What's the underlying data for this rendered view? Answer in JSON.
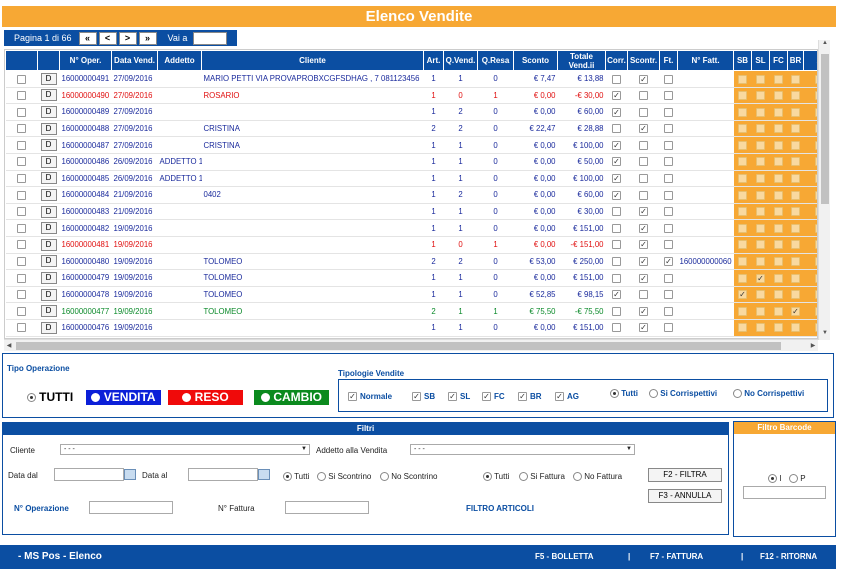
{
  "title": "Elenco Vendite",
  "pager": {
    "page_label": "Pagina 1 di 66",
    "first": "«",
    "prev": "<",
    "next": ">",
    "last": "»",
    "goto_label": "Vai a",
    "goto_value": ""
  },
  "table": {
    "headers": [
      "",
      "",
      "N° Oper.",
      "Data Vend.",
      "Addetto",
      "Cliente",
      "Art.",
      "Q.Vend.",
      "Q.Resa",
      "Sconto",
      "Totale Vend.ii",
      "Corr.",
      "Scontr.",
      "Ft.",
      "N° Fatt.",
      "SB",
      "SL",
      "FC",
      "BR",
      "A"
    ],
    "detail_label": "D",
    "rows": [
      {
        "color": "blue",
        "oper": "16000000491",
        "date": "27/09/2016",
        "addetto": "",
        "cliente": "MARIO PETTI VIA PROVAPROBXCGFSDHAG , 7 081123456",
        "art": "1",
        "qv": "1",
        "qr": "0",
        "sconto": "€ 7,47",
        "totale": "€ 13,88",
        "corr": false,
        "scontr": true,
        "ft": false,
        "fatt": "",
        "sb": false,
        "sl": false,
        "fc": false,
        "br": false,
        "a": false
      },
      {
        "color": "red",
        "oper": "16000000490",
        "date": "27/09/2016",
        "addetto": "",
        "cliente": "ROSARIO",
        "art": "1",
        "qv": "0",
        "qr": "1",
        "sconto": "€ 0,00",
        "totale": "-€ 30,00",
        "corr": true,
        "scontr": false,
        "ft": false,
        "fatt": "",
        "sb": false,
        "sl": false,
        "fc": false,
        "br": false,
        "a": false
      },
      {
        "color": "blue",
        "oper": "16000000489",
        "date": "27/09/2016",
        "addetto": "",
        "cliente": "",
        "art": "1",
        "qv": "2",
        "qr": "0",
        "sconto": "€ 0,00",
        "totale": "€ 60,00",
        "corr": true,
        "scontr": false,
        "ft": false,
        "fatt": "",
        "sb": false,
        "sl": false,
        "fc": false,
        "br": false,
        "a": false
      },
      {
        "color": "blue",
        "oper": "16000000488",
        "date": "27/09/2016",
        "addetto": "",
        "cliente": "CRISTINA",
        "art": "2",
        "qv": "2",
        "qr": "0",
        "sconto": "€ 22,47",
        "totale": "€ 28,88",
        "corr": false,
        "scontr": true,
        "ft": false,
        "fatt": "",
        "sb": false,
        "sl": false,
        "fc": false,
        "br": false,
        "a": false
      },
      {
        "color": "blue",
        "oper": "16000000487",
        "date": "27/09/2016",
        "addetto": "",
        "cliente": "CRISTINA",
        "art": "1",
        "qv": "1",
        "qr": "0",
        "sconto": "€ 0,00",
        "totale": "€ 100,00",
        "corr": true,
        "scontr": false,
        "ft": false,
        "fatt": "",
        "sb": false,
        "sl": false,
        "fc": false,
        "br": false,
        "a": true
      },
      {
        "color": "blue",
        "oper": "16000000486",
        "date": "26/09/2016",
        "addetto": "ADDETTO 1",
        "cliente": "",
        "art": "1",
        "qv": "1",
        "qr": "0",
        "sconto": "€ 0,00",
        "totale": "€ 50,00",
        "corr": true,
        "scontr": false,
        "ft": false,
        "fatt": "",
        "sb": false,
        "sl": false,
        "fc": false,
        "br": false,
        "a": false
      },
      {
        "color": "blue",
        "oper": "16000000485",
        "date": "26/09/2016",
        "addetto": "ADDETTO 1",
        "cliente": "",
        "art": "1",
        "qv": "1",
        "qr": "0",
        "sconto": "€ 0,00",
        "totale": "€ 100,00",
        "corr": true,
        "scontr": false,
        "ft": false,
        "fatt": "",
        "sb": false,
        "sl": false,
        "fc": false,
        "br": false,
        "a": false
      },
      {
        "color": "blue",
        "oper": "16000000484",
        "date": "21/09/2016",
        "addetto": "",
        "cliente": "0402",
        "art": "1",
        "qv": "2",
        "qr": "0",
        "sconto": "€ 0,00",
        "totale": "€ 60,00",
        "corr": true,
        "scontr": false,
        "ft": false,
        "fatt": "",
        "sb": false,
        "sl": false,
        "fc": false,
        "br": false,
        "a": false
      },
      {
        "color": "blue",
        "oper": "16000000483",
        "date": "21/09/2016",
        "addetto": "",
        "cliente": "",
        "art": "1",
        "qv": "1",
        "qr": "0",
        "sconto": "€ 0,00",
        "totale": "€ 30,00",
        "corr": false,
        "scontr": true,
        "ft": false,
        "fatt": "",
        "sb": false,
        "sl": false,
        "fc": false,
        "br": false,
        "a": false
      },
      {
        "color": "blue",
        "oper": "16000000482",
        "date": "19/09/2016",
        "addetto": "",
        "cliente": "",
        "art": "1",
        "qv": "1",
        "qr": "0",
        "sconto": "€ 0,00",
        "totale": "€ 151,00",
        "corr": false,
        "scontr": true,
        "ft": false,
        "fatt": "",
        "sb": false,
        "sl": false,
        "fc": false,
        "br": false,
        "a": false
      },
      {
        "color": "red",
        "oper": "16000000481",
        "date": "19/09/2016",
        "addetto": "",
        "cliente": "",
        "art": "1",
        "qv": "0",
        "qr": "1",
        "sconto": "€ 0,00",
        "totale": "-€ 151,00",
        "corr": false,
        "scontr": true,
        "ft": false,
        "fatt": "",
        "sb": false,
        "sl": false,
        "fc": false,
        "br": false,
        "a": false
      },
      {
        "color": "blue",
        "oper": "16000000480",
        "date": "19/09/2016",
        "addetto": "",
        "cliente": "TOLOMEO",
        "art": "2",
        "qv": "2",
        "qr": "0",
        "sconto": "€ 53,00",
        "totale": "€ 250,00",
        "corr": false,
        "scontr": true,
        "ft": true,
        "fatt": "160000000060",
        "sb": false,
        "sl": false,
        "fc": false,
        "br": false,
        "a": false
      },
      {
        "color": "blue",
        "oper": "16000000479",
        "date": "19/09/2016",
        "addetto": "",
        "cliente": "TOLOMEO",
        "art": "1",
        "qv": "1",
        "qr": "0",
        "sconto": "€ 0,00",
        "totale": "€ 151,00",
        "corr": false,
        "scontr": true,
        "ft": false,
        "fatt": "",
        "sb": false,
        "sl": true,
        "fc": false,
        "br": false,
        "a": false
      },
      {
        "color": "blue",
        "oper": "16000000478",
        "date": "19/09/2016",
        "addetto": "",
        "cliente": "TOLOMEO",
        "art": "1",
        "qv": "1",
        "qr": "0",
        "sconto": "€ 52,85",
        "totale": "€ 98,15",
        "corr": true,
        "scontr": false,
        "ft": false,
        "fatt": "",
        "sb": true,
        "sl": false,
        "fc": false,
        "br": false,
        "a": false
      },
      {
        "color": "green",
        "oper": "16000000477",
        "date": "19/09/2016",
        "addetto": "",
        "cliente": "TOLOMEO",
        "art": "2",
        "qv": "1",
        "qr": "1",
        "sconto": "€ 75,50",
        "totale": "-€ 75,50",
        "corr": false,
        "scontr": true,
        "ft": false,
        "fatt": "",
        "sb": false,
        "sl": false,
        "fc": false,
        "br": true,
        "a": false
      },
      {
        "color": "blue",
        "oper": "16000000476",
        "date": "19/09/2016",
        "addetto": "",
        "cliente": "",
        "art": "1",
        "qv": "1",
        "qr": "0",
        "sconto": "€ 0,00",
        "totale": "€ 151,00",
        "corr": false,
        "scontr": true,
        "ft": false,
        "fatt": "",
        "sb": false,
        "sl": false,
        "fc": false,
        "br": false,
        "a": false
      }
    ]
  },
  "tipo_operazione": {
    "title": "Tipo Operazione",
    "tutti": "TUTTI",
    "vendita": "VENDITA",
    "reso": "RESO",
    "cambio": "CAMBIO",
    "colors": {
      "vendita": "#0b1fd8",
      "reso": "#f00a0a",
      "cambio": "#0b8a1e"
    }
  },
  "tipologie": {
    "title": "Tipologie Vendite",
    "items": [
      "Normale",
      "SB",
      "SL",
      "FC",
      "BR",
      "AG"
    ],
    "radios": [
      "Tutti",
      "Si Corrispettivi",
      "No Corrispettivi"
    ]
  },
  "filtri": {
    "title": "Filtri",
    "cliente_label": "Cliente",
    "cliente_value": "- - -",
    "addetto_label": "Addetto alla Vendita",
    "addetto_value": "- - -",
    "data_dal": "Data dal",
    "data_al": "Data al",
    "scontrino_radios": [
      "Tutti",
      "Si Scontrino",
      "No Scontrino"
    ],
    "fattura_radios": [
      "Tutti",
      "Si Fattura",
      "No Fattura"
    ],
    "filtra": "F2 - FILTRA",
    "annulla": "F3 - ANNULLA",
    "operazione_label": "N° Operazione",
    "fattura_label": "N° Fattura",
    "articoli": "FILTRO ARTICOLI"
  },
  "barcode": {
    "title": "Filtro Barcode",
    "opt_i": "I",
    "opt_p": "P"
  },
  "footer": {
    "app": "- MS Pos - Elenco",
    "f5": "F5 - BOLLETTA",
    "sep": "|",
    "f7": "F7 - FATTURA",
    "f12": "F12 - RITORNA"
  },
  "colors": {
    "accent": "#f7a834",
    "brand": "#0b4ea2"
  }
}
